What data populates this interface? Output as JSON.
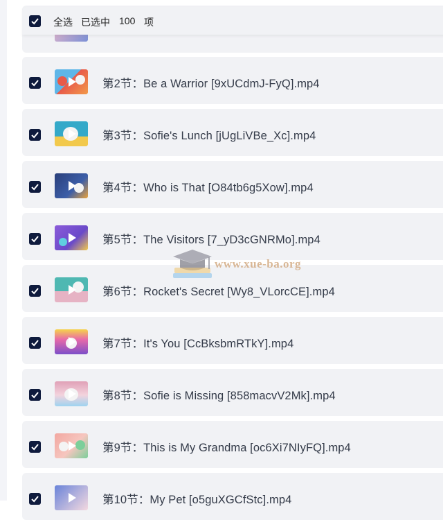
{
  "header": {
    "select_all_label": "全选",
    "selected_label": "已选中",
    "selected_count": "100",
    "selected_unit": "项"
  },
  "items": [
    {
      "title": "",
      "thumb_colors": [
        "#e9b7c9",
        "#7a8fd6"
      ]
    },
    {
      "title": "第2节：Be a Warrior [9xUCdmJ-FyQ].mp4",
      "thumb_colors": [
        "#5fb6e8",
        "#e85a4a"
      ]
    },
    {
      "title": "第3节：Sofie's Lunch [jUgLiVBe_Xc].mp4",
      "thumb_colors": [
        "#34a9c9",
        "#f4f4f4"
      ]
    },
    {
      "title": "第4节：Who is That [O84tb6g5Xow].mp4",
      "thumb_colors": [
        "#2a3f7a",
        "#e8a23d"
      ]
    },
    {
      "title": "第5节：The Visitors [7_yD3cGNRMo].mp4",
      "thumb_colors": [
        "#8b5bd9",
        "#f2c94c"
      ]
    },
    {
      "title": "第6节：Rocket's  Secret [Wy8_VLorcCE].mp4",
      "thumb_colors": [
        "#4fb8b2",
        "#f4f4f4"
      ]
    },
    {
      "title": "第7节：It's You [CcBksbmRTkY].mp4",
      "thumb_colors": [
        "#e86aa8",
        "#f6d34a"
      ]
    },
    {
      "title": "第8节：Sofie is Missing [858macvV2Mk].mp4",
      "thumb_colors": [
        "#e0a1b7",
        "#9ed3f0"
      ]
    },
    {
      "title": "第9节：This is My Grandma [oc6Xi7NIyFQ].mp4",
      "thumb_colors": [
        "#f2a7a0",
        "#7ccf9a"
      ]
    },
    {
      "title": "第10节：My Pet [o5guXGCfStc].mp4",
      "thumb_colors": [
        "#6a84d9",
        "#f4d9e0"
      ]
    }
  ],
  "watermark": {
    "text": "www.xue-ba.org",
    "icon": "graduation-cap-icon"
  },
  "colors": {
    "checkbox": "#0f1b3d",
    "row_bg": "#f1f2f5"
  }
}
